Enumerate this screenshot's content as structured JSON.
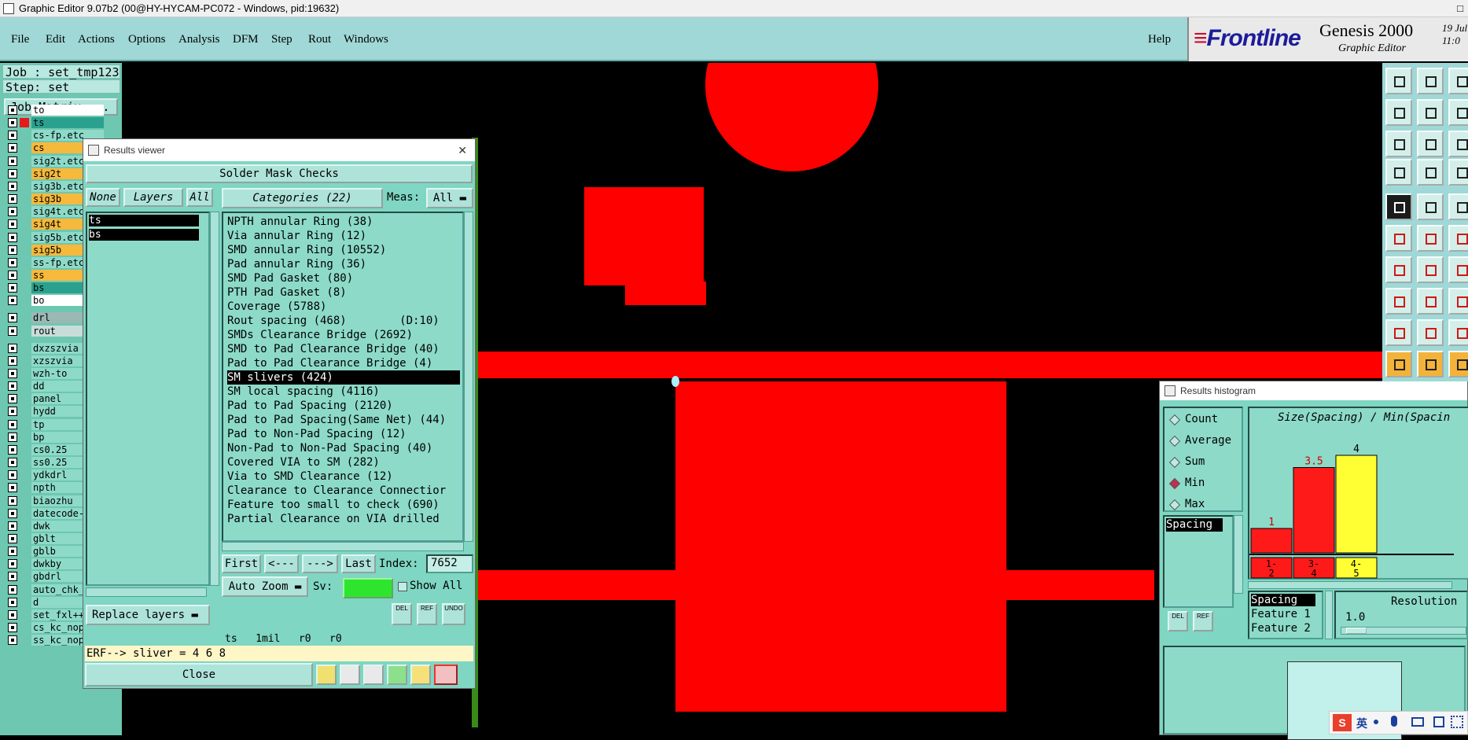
{
  "window": {
    "title": "Graphic Editor 9.07b2 (00@HY-HYCAM-PC072 - Windows, pid:19632)",
    "window_control": "□"
  },
  "menu": {
    "items": [
      "File",
      "Edit",
      "Actions",
      "Options",
      "Analysis",
      "DFM",
      "Step",
      "Rout",
      "Windows"
    ],
    "help": "Help"
  },
  "brand": {
    "logo_main": "Frontline",
    "product": "Genesis 2000",
    "subtitle": "Graphic Editor",
    "date_line1": "19 Jul",
    "date_line2": "11:0"
  },
  "job": {
    "job_label": "Job : set_tmp123",
    "step_label": "Step: set",
    "matrix_button": "Job Matrix ..."
  },
  "layers": [
    {
      "name": "to",
      "color": "#ffffff"
    },
    {
      "name": "ts",
      "color": "#2aa18e"
    },
    {
      "name": "cs-fp.etc",
      "color": "#8ddac8"
    },
    {
      "name": "cs",
      "color": "#f6b93b"
    },
    {
      "name": "sig2t.etc",
      "color": "#8ddac8"
    },
    {
      "name": "sig2t",
      "color": "#f6b93b"
    },
    {
      "name": "sig3b.etc",
      "color": "#8ddac8"
    },
    {
      "name": "sig3b",
      "color": "#f6b93b"
    },
    {
      "name": "sig4t.etc",
      "color": "#8ddac8"
    },
    {
      "name": "sig4t",
      "color": "#f6b93b"
    },
    {
      "name": "sig5b.etc",
      "color": "#8ddac8"
    },
    {
      "name": "sig5b",
      "color": "#f6b93b"
    },
    {
      "name": "ss-fp.etc",
      "color": "#8ddac8"
    },
    {
      "name": "ss",
      "color": "#f6b93b"
    },
    {
      "name": "bs",
      "color": "#2aa18e"
    },
    {
      "name": "bo",
      "color": "#ffffff"
    },
    {
      "name": "drl",
      "color": "#9bb8b4"
    },
    {
      "name": "rout",
      "color": "#c8ddd9"
    },
    {
      "name": "dxzszvia",
      "color": "#8ddac8"
    },
    {
      "name": "xzszvia",
      "color": "#8ddac8"
    },
    {
      "name": "wzh-to",
      "color": "#8ddac8"
    },
    {
      "name": "dd",
      "color": "#8ddac8"
    },
    {
      "name": "panel",
      "color": "#8ddac8"
    },
    {
      "name": "hydd",
      "color": "#8ddac8"
    },
    {
      "name": "tp",
      "color": "#8ddac8"
    },
    {
      "name": "bp",
      "color": "#8ddac8"
    },
    {
      "name": "cs0.25",
      "color": "#8ddac8"
    },
    {
      "name": "ss0.25",
      "color": "#8ddac8"
    },
    {
      "name": "ydkdrl",
      "color": "#8ddac8"
    },
    {
      "name": "npth",
      "color": "#8ddac8"
    },
    {
      "name": "biaozhu",
      "color": "#8ddac8"
    },
    {
      "name": "datecode-",
      "color": "#8ddac8"
    },
    {
      "name": "dwk",
      "color": "#8ddac8"
    },
    {
      "name": "gblt",
      "color": "#8ddac8"
    },
    {
      "name": "gblb",
      "color": "#8ddac8"
    },
    {
      "name": "dwkby",
      "color": "#8ddac8"
    },
    {
      "name": "gbdrl",
      "color": "#8ddac8"
    },
    {
      "name": "auto_chk_",
      "color": "#8ddac8"
    },
    {
      "name": "d",
      "color": "#8ddac8"
    },
    {
      "name": "set_fxl++",
      "color": "#8ddac8"
    },
    {
      "name": "cs_kc_nopad",
      "color": "#8ddac8"
    },
    {
      "name": "ss_kc_nopad",
      "color": "#8ddac8"
    }
  ],
  "results_viewer": {
    "title": "Results viewer",
    "close_x": "✕",
    "check_name": "Solder Mask Checks",
    "none_btn": "None",
    "layers_btn": "Layers",
    "all_btn": "All",
    "layer_list": [
      "ts",
      "bs"
    ],
    "categories_btn": "Categories (22)",
    "meas_label": "Meas:",
    "meas_value": "All",
    "categories": [
      "NPTH annular Ring (38)",
      "Via annular Ring (12)",
      "SMD annular Ring (10552)",
      "Pad annular Ring (36)",
      "SMD Pad Gasket (80)",
      "PTH Pad Gasket (8)",
      "Coverage (5788)",
      "Rout spacing (468)        (D:10)",
      "SMDs Clearance Bridge (2692)",
      "SMD to Pad Clearance Bridge (40)",
      "Pad to Pad Clearance Bridge (4)",
      "SM slivers (424)",
      "SM local spacing (4116)",
      "Pad to Pad Spacing (2120)",
      "Pad to Pad Spacing(Same Net) (44)",
      "Pad to Non-Pad Spacing (12)",
      "Non-Pad to Non-Pad Spacing (40)",
      "Covered VIA to SM (282)",
      "Via to SMD Clearance (12)",
      "Clearance to Clearance Connectior",
      "Feature too small to check (690)",
      "Partial Clearance on VIA drilled"
    ],
    "selected_index": 11,
    "nav": {
      "first": "First",
      "prev": "<---",
      "next": "--->",
      "last": "Last",
      "index_label": "Index:",
      "index_value": "7652"
    },
    "auto_zoom": "Auto Zoom",
    "sv_label": "Sv:",
    "show_all": "Show All",
    "replace_layers": "Replace layers",
    "icon_labels": {
      "del": "DEL",
      "ref": "REF",
      "undo": "UNDO"
    },
    "status_line": "ts   1mil   r0   r0",
    "erf_line": "ERF--> sliver = 4 6 8",
    "close_btn": "Close"
  },
  "histogram": {
    "title": "Results histogram",
    "modes": [
      "Count",
      "Average",
      "Sum",
      "Min",
      "Max"
    ],
    "selected_mode": "Min",
    "list": [
      "Spacing"
    ],
    "icon_labels": {
      "del": "DEL",
      "ref": "REF"
    },
    "chart_title": "Size(Spacing) / Min(Spacin",
    "table_header": "Spacing",
    "table_rows": [
      "Feature 1",
      "Feature 2"
    ],
    "resolution_label": "Resolution",
    "resolution_value": "1.0",
    "bars": [
      {
        "bin_line1": "1-",
        "bin_line2": "2",
        "value": 1,
        "value_label": "1",
        "color": "#ff1a1a"
      },
      {
        "bin_line1": "3-",
        "bin_line2": "4",
        "value": 3.5,
        "value_label": "3.5",
        "color": "#ff1a1a"
      },
      {
        "bin_line1": "4-",
        "bin_line2": "5",
        "value": 4,
        "value_label": "4",
        "color": "#ffff33"
      }
    ]
  },
  "colors": {
    "background": "#000000",
    "feature": "#ff0000",
    "panel": "#7fd6c2",
    "menu": "#9fd8d6"
  },
  "ime": [
    "英"
  ]
}
